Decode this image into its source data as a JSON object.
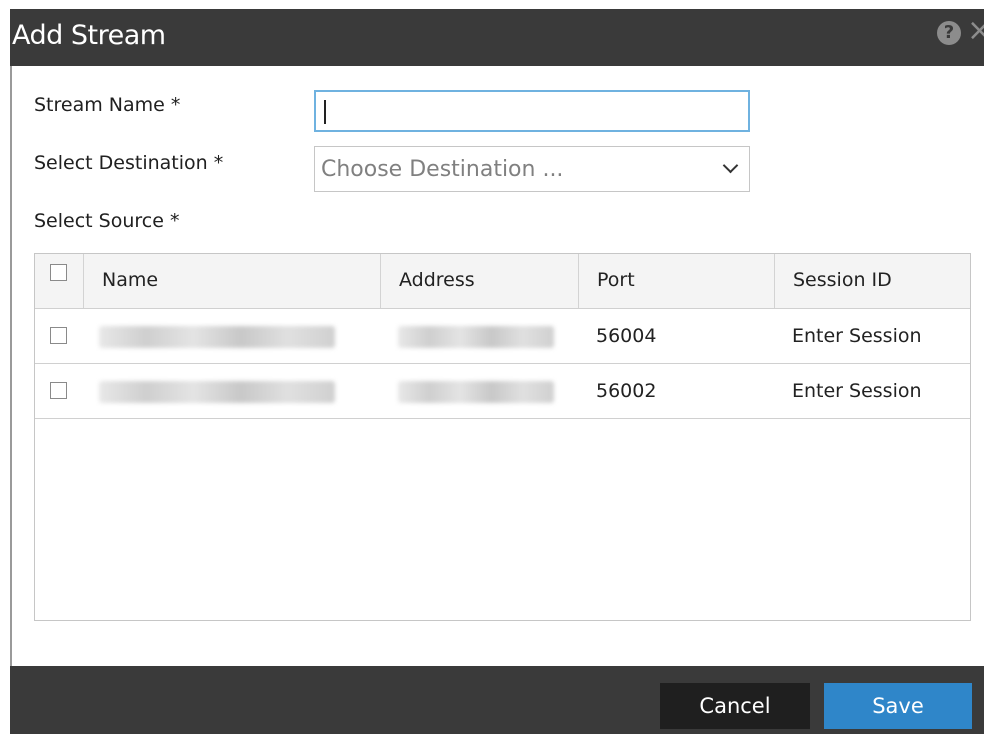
{
  "dialog": {
    "title": "Add Stream",
    "help_icon": "question-circle-icon",
    "close_icon": "close-icon"
  },
  "form": {
    "stream_name_label": "Stream Name *",
    "stream_name_value": "",
    "destination_label": "Select Destination *",
    "destination_placeholder": "Choose Destination ...",
    "source_label": "Select Source *"
  },
  "table": {
    "columns": [
      "Name",
      "Address",
      "Port",
      "Session ID"
    ],
    "rows": [
      {
        "port": "56004",
        "session_id": "Enter Session"
      },
      {
        "port": "56002",
        "session_id": "Enter Session"
      }
    ]
  },
  "footer": {
    "cancel_label": "Cancel",
    "save_label": "Save"
  },
  "colors": {
    "titlebar": "#3a3a3a",
    "save_button": "#2f86c9",
    "cancel_button": "#1f1f1f",
    "focus_border": "#6fb2e0"
  }
}
